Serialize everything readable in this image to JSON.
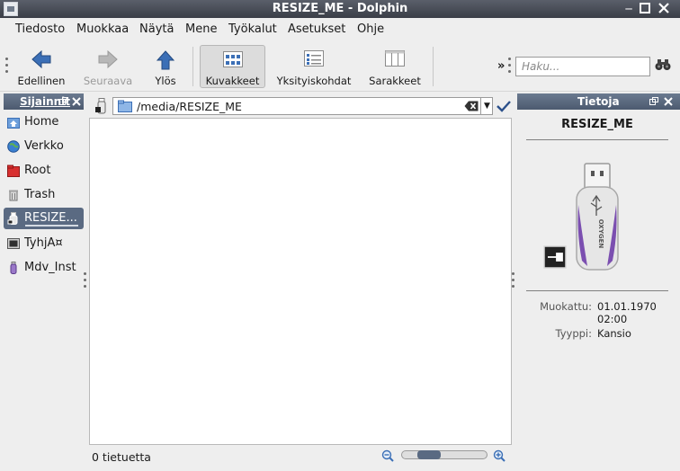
{
  "window": {
    "title": "RESIZE_ME - Dolphin"
  },
  "menu": [
    "Tiedosto",
    "Muokkaa",
    "Näytä",
    "Mene",
    "Työkalut",
    "Asetukset",
    "Ohje"
  ],
  "toolbar": {
    "back_label": "Edellinen",
    "forward_label": "Seuraava",
    "up_label": "Ylös",
    "icons_label": "Kuvakkeet",
    "details_label": "Yksityiskohdat",
    "columns_label": "Sarakkeet",
    "overflow": "»",
    "search_placeholder": "Haku..."
  },
  "places": {
    "title": "Sijainnit",
    "items": [
      {
        "label": "Home"
      },
      {
        "label": "Verkko"
      },
      {
        "label": "Root"
      },
      {
        "label": "Trash"
      },
      {
        "label": "RESIZE..."
      },
      {
        "label": "TyhjÃ¤"
      },
      {
        "label": "Mdv_Inst"
      }
    ]
  },
  "location": {
    "path": "/media/RESIZE_ME"
  },
  "status": {
    "text": "0 tietuetta",
    "zoom_level": 0.25
  },
  "info": {
    "title": "Tietoja",
    "name": "RESIZE_ME",
    "device_brand": "OXYGEN",
    "modified_label": "Muokattu:",
    "modified_date": "01.01.1970",
    "modified_time": "02:00",
    "type_label": "Tyyppi:",
    "type_value": "Kansio"
  },
  "colors": {
    "panel_header": "#5a6a82",
    "selected": "#5a6a82",
    "usb_purple": "#7b4fb0"
  }
}
